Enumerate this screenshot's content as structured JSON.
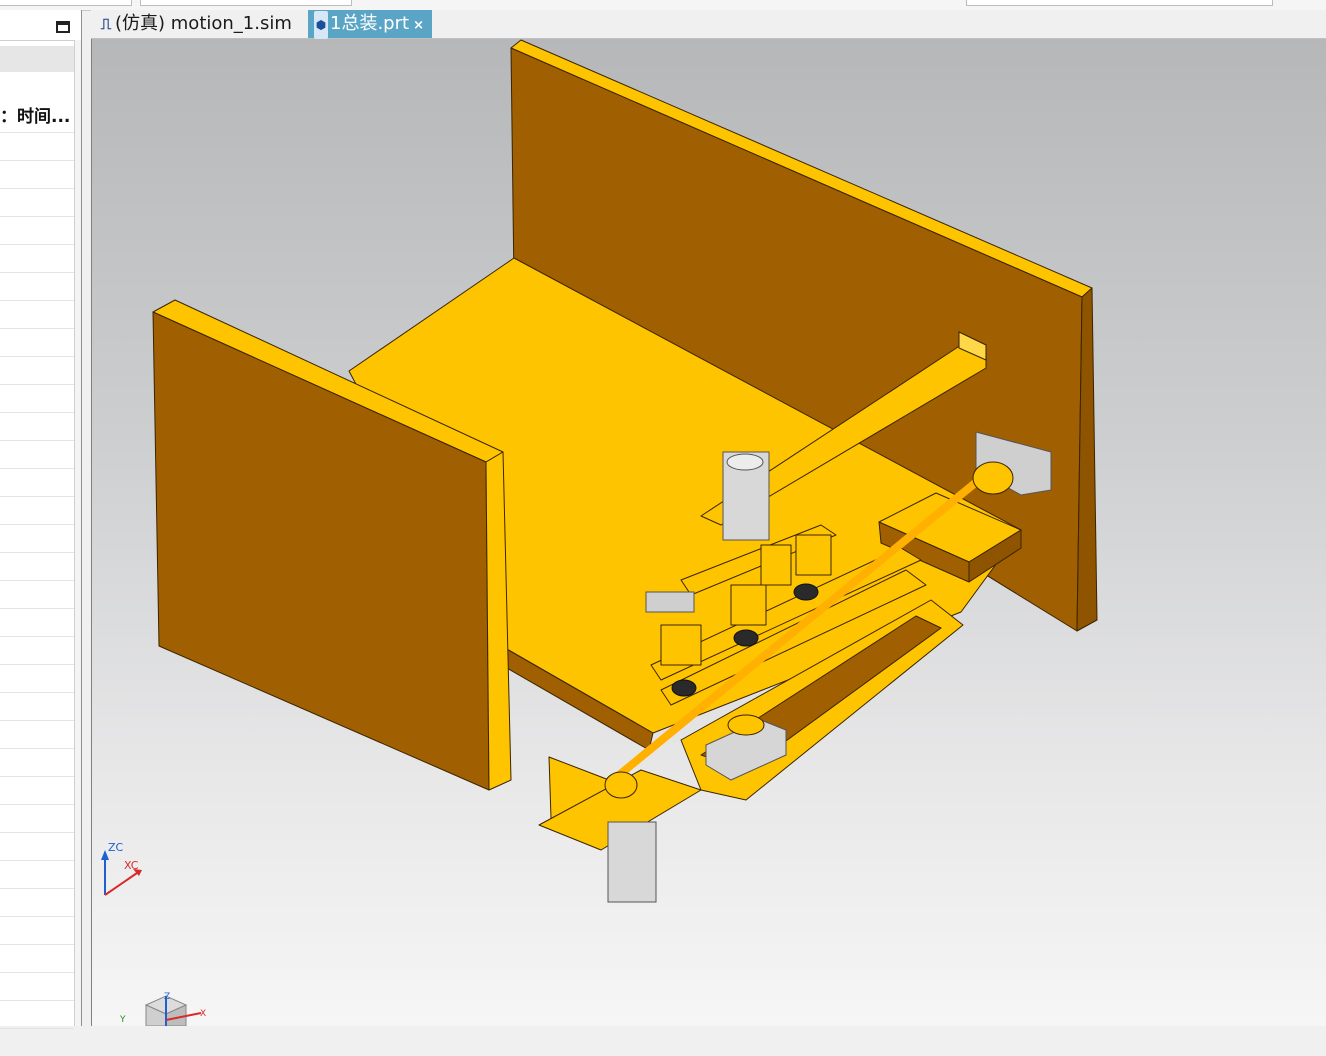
{
  "tabs": [
    {
      "label": "(仿真) motion_1.sim",
      "icon": "motion-sim-icon",
      "active": false
    },
    {
      "label": "1总装.prt",
      "icon": "part-file-icon",
      "active": true,
      "close": "×"
    }
  ],
  "left_panel": {
    "column_header": "：时间..."
  },
  "viewport": {
    "triad_labels": {
      "z": "ZC",
      "x": "XC"
    },
    "view_cube_labels": {
      "z": "Z",
      "y": "Y",
      "x": "X"
    }
  },
  "colors": {
    "part_body": "#FFC400",
    "part_side": "#A05F00",
    "active_tab": "#5AA5C6",
    "axis_blue": "#1f5fd1",
    "axis_red": "#d62b2b"
  }
}
